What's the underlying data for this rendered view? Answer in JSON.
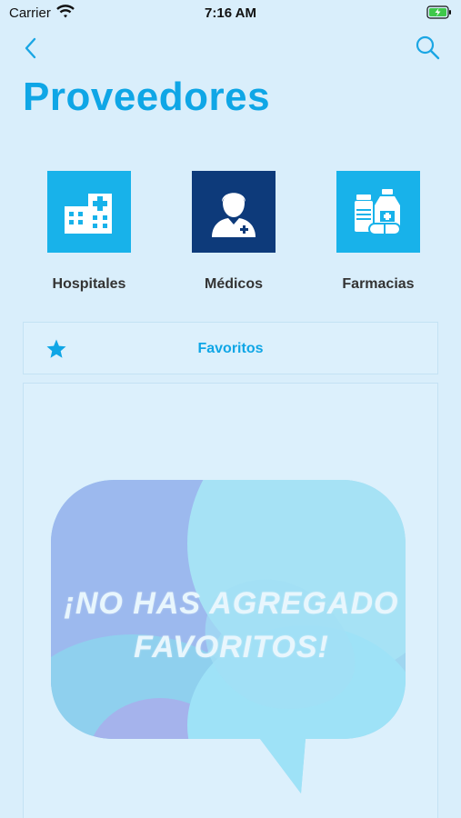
{
  "status_bar": {
    "carrier": "Carrier",
    "time": "7:16 AM"
  },
  "header": {
    "title": "Proveedores"
  },
  "categories": [
    {
      "label": "Hospitales",
      "icon": "hospital-building-icon"
    },
    {
      "label": "Médicos",
      "icon": "doctor-icon"
    },
    {
      "label": "Farmacias",
      "icon": "medicine-bottles-icon"
    }
  ],
  "favorites": {
    "label": "Favoritos",
    "empty_line1": "¡NO HAS AGREGADO",
    "empty_line2": "FAVORITOS!"
  },
  "colors": {
    "accent": "#0fa6e6",
    "tile_light": "#18b2ea",
    "tile_dark": "#0d3a7a",
    "background": "#d9eefb"
  }
}
